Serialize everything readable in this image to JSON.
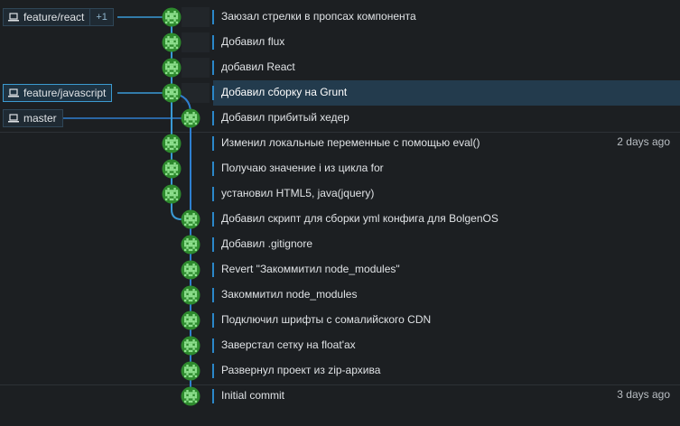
{
  "branches": {
    "feature_react": {
      "name": "feature/react",
      "extra": "+1"
    },
    "feature_javascript": {
      "name": "feature/javascript"
    },
    "master": {
      "name": "master"
    }
  },
  "commits": [
    {
      "message": "Заюзал стрелки в пропсах компонента",
      "time": "",
      "lane": 0
    },
    {
      "message": "Добавил flux",
      "time": "",
      "lane": 0
    },
    {
      "message": "добавил React",
      "time": "",
      "lane": 0
    },
    {
      "message": "Добавил сборку на Grunt",
      "time": "",
      "lane": 0,
      "selected": true
    },
    {
      "message": "Добавил прибитый хедер",
      "time": "",
      "lane": 1
    },
    {
      "message": "Изменил локальные переменные с помощью eval()",
      "time": "2 days ago",
      "lane": 0
    },
    {
      "message": "Получаю значение i из цикла for",
      "time": "",
      "lane": 0
    },
    {
      "message": "установил HTML5, java(jquery)",
      "time": "",
      "lane": 0
    },
    {
      "message": "Добавил скрипт для сборки yml конфига для BolgenOS",
      "time": "",
      "lane": 1
    },
    {
      "message": "Добавил .gitignore",
      "time": "",
      "lane": 1
    },
    {
      "message": "Revert \"Закоммитил node_modules\"",
      "time": "",
      "lane": 1
    },
    {
      "message": "Закоммитил node_modules",
      "time": "",
      "lane": 1
    },
    {
      "message": "Подключил шрифты с сомалийского CDN",
      "time": "",
      "lane": 1
    },
    {
      "message": "Заверстал сетку на float'ах",
      "time": "",
      "lane": 1
    },
    {
      "message": "Развернул проект из zip-архива",
      "time": "",
      "lane": 1
    },
    {
      "message": "Initial commit",
      "time": "3 days ago",
      "lane": 1
    }
  ],
  "colors": {
    "lane0": "#3a9ad6",
    "lane1": "#2f7fd0",
    "avatar_bg": "#2e8a2e",
    "avatar_fg": "#8ee08e",
    "selected_bg": "#233b4d"
  },
  "icons": {
    "branch": "laptop-icon",
    "avatar": "identicon-avatar"
  }
}
